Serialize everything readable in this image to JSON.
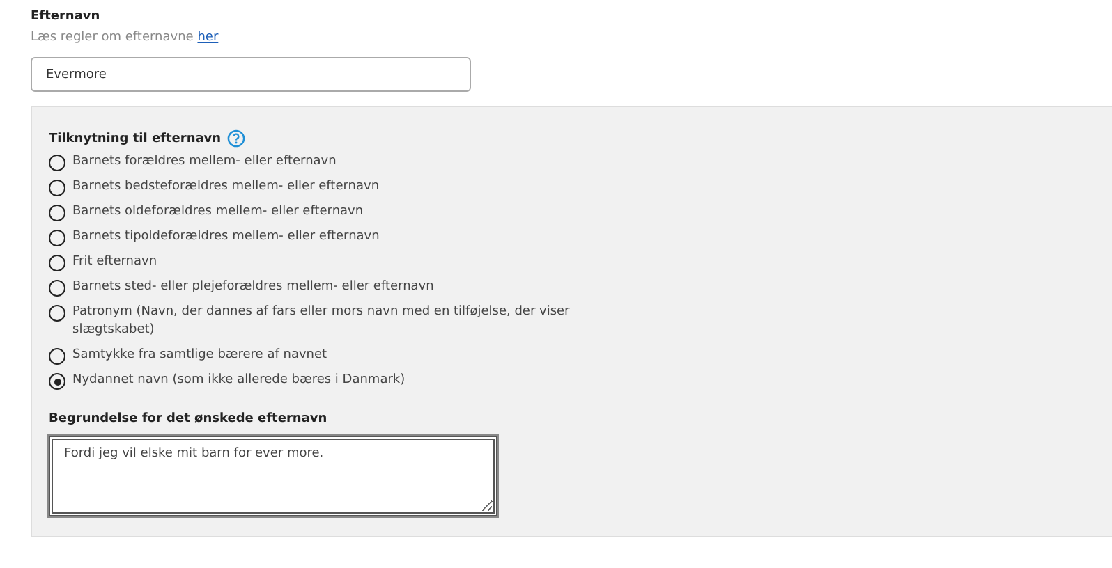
{
  "surname": {
    "label": "Efternavn",
    "hint": "Læs regler om efternavne",
    "hint_link": "her",
    "value": "Evermore"
  },
  "attachment": {
    "heading": "Tilknytning til efternavn",
    "options": [
      {
        "label": "Barnets forældres mellem- eller efternavn",
        "selected": false
      },
      {
        "label": "Barnets bedsteforældres mellem- eller efternavn",
        "selected": false
      },
      {
        "label": "Barnets oldeforældres mellem- eller efternavn",
        "selected": false
      },
      {
        "label": "Barnets tipoldeforældres mellem- eller efternavn",
        "selected": false
      },
      {
        "label": "Frit efternavn",
        "selected": false
      },
      {
        "label": "Barnets sted- eller plejeforældres mellem- eller efternavn",
        "selected": false
      },
      {
        "label": "Patronym (Navn, der dannes af fars eller mors navn med en tilføjelse, der viser slægtskabet)",
        "selected": false
      },
      {
        "label": "Samtykke fra samtlige bærere af navnet",
        "selected": false
      },
      {
        "label": "Nydannet navn (som ikke allerede bæres i Danmark)",
        "selected": true
      }
    ]
  },
  "reason": {
    "label": "Begrundelse for det ønskede efternavn",
    "value": "Fordi jeg vil elske mit barn for ever more."
  }
}
